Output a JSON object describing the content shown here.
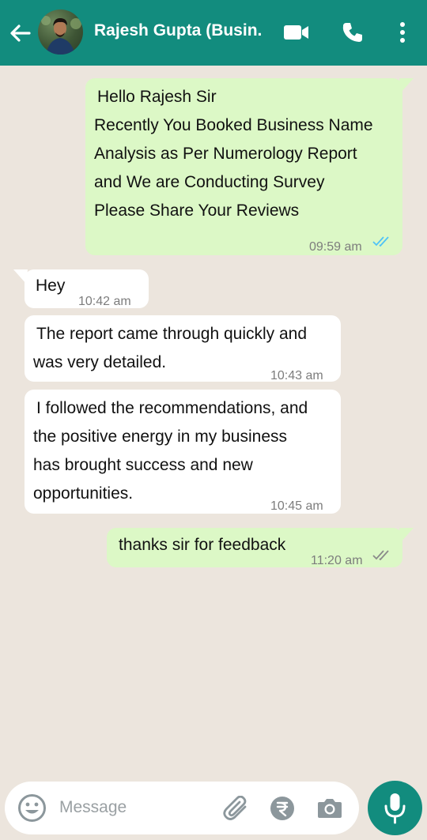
{
  "header": {
    "contact_name": "Rajesh Gupta (Busin.",
    "icons": [
      "back-arrow-icon",
      "avatar",
      "video-call-icon",
      "phone-icon",
      "more-options-icon"
    ]
  },
  "messages": [
    {
      "direction": "outgoing",
      "lines": [
        "Hello Rajesh Sir",
        "Recently You Booked Business Name",
        "Analysis as Per Numerology Report",
        "and We are Conducting Survey",
        "Please Share Your Reviews"
      ],
      "time": "09:59 am",
      "status": "read"
    },
    {
      "direction": "incoming",
      "lines": [
        "Hey"
      ],
      "time": "10:42 am"
    },
    {
      "direction": "incoming",
      "lines": [
        "The report came through quickly and",
        "was very detailed."
      ],
      "time": "10:43 am"
    },
    {
      "direction": "incoming",
      "lines": [
        "I followed the recommendations, and",
        "the positive energy in my business",
        "has brought success and new",
        "opportunities."
      ],
      "time": "10:45 am"
    },
    {
      "direction": "outgoing",
      "lines": [
        "thanks sir for feedback"
      ],
      "time": "11:20 am",
      "status": "delivered"
    }
  ],
  "composer": {
    "placeholder": "Message",
    "icons": [
      "emoji-icon",
      "attach-icon",
      "rupee-payment-icon",
      "camera-icon",
      "mic-icon"
    ]
  },
  "colors": {
    "header": "#128c7e",
    "outgoing_bubble": "#dcf8c6",
    "incoming_bubble": "#ffffff",
    "read_ticks": "#4fc3f7",
    "chat_background": "#ece5dd"
  }
}
